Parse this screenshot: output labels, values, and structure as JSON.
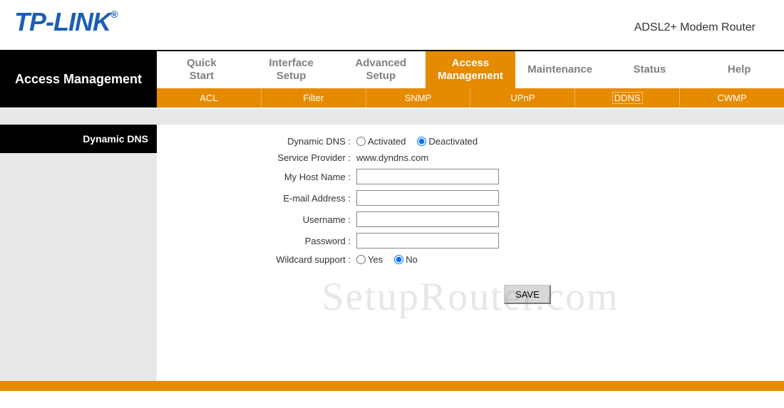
{
  "header": {
    "brand": "TP-LINK",
    "registered": "®",
    "device": "ADSL2+ Modem Router"
  },
  "section_title": "Access Management",
  "main_tabs": [
    {
      "label": "Quick Start",
      "active": false
    },
    {
      "label": "Interface Setup",
      "active": false
    },
    {
      "label": "Advanced Setup",
      "active": false
    },
    {
      "label": "Access Management",
      "active": true
    },
    {
      "label": "Maintenance",
      "active": false
    },
    {
      "label": "Status",
      "active": false
    },
    {
      "label": "Help",
      "active": false
    }
  ],
  "sub_tabs": [
    {
      "label": "ACL",
      "active": false
    },
    {
      "label": "Filter",
      "active": false
    },
    {
      "label": "SNMP",
      "active": false
    },
    {
      "label": "UPnP",
      "active": false
    },
    {
      "label": "DDNS",
      "active": true
    },
    {
      "label": "CWMP",
      "active": false
    }
  ],
  "page_header": "Dynamic DNS",
  "form": {
    "ddns_label": "Dynamic DNS :",
    "ddns_opt_activated": "Activated",
    "ddns_opt_deactivated": "Deactivated",
    "ddns_selected": "deactivated",
    "provider_label": "Service Provider :",
    "provider_value": "www.dyndns.com",
    "host_label": "My Host Name :",
    "host_value": "",
    "email_label": "E-mail Address :",
    "email_value": "",
    "username_label": "Username :",
    "username_value": "",
    "password_label": "Password :",
    "password_value": "",
    "wildcard_label": "Wildcard support :",
    "wildcard_yes": "Yes",
    "wildcard_no": "No",
    "wildcard_selected": "no",
    "save_label": "SAVE"
  },
  "watermark": "SetupRouter.com"
}
